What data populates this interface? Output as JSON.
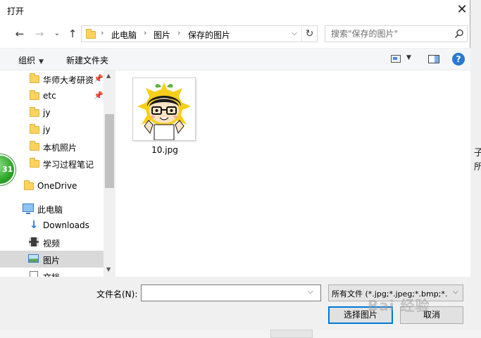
{
  "window": {
    "title": "打开"
  },
  "nav": {
    "back_glyph": "←",
    "forward_glyph": "→",
    "recent_glyph": "⌄",
    "up_glyph": "↑"
  },
  "address": {
    "crumbs": [
      "此电脑",
      "图片",
      "保存的图片"
    ],
    "separator": "›",
    "refresh_glyph": "↻"
  },
  "search": {
    "placeholder": "搜索\"保存的图片\""
  },
  "toolbar": {
    "organize_label": "组织",
    "new_folder_label": "新建文件夹",
    "help_label": "?"
  },
  "sidebar": {
    "items": [
      {
        "label": "华师大考研资",
        "icon": "folder-icon",
        "pinned": true
      },
      {
        "label": "etc",
        "icon": "folder-icon",
        "pinned": true
      },
      {
        "label": "jy",
        "icon": "folder-icon",
        "pinned": false
      },
      {
        "label": "jy",
        "icon": "folder-icon",
        "pinned": false
      },
      {
        "label": "本机照片",
        "icon": "folder-icon",
        "pinned": false
      },
      {
        "label": "学习过程笔记",
        "icon": "folder-icon",
        "pinned": false
      },
      {
        "label": "OneDrive",
        "icon": "onedrive-icon",
        "pinned": false
      },
      {
        "label": "此电脑",
        "icon": "computer-icon",
        "pinned": false
      },
      {
        "label": "Downloads",
        "icon": "download-icon",
        "pinned": false
      },
      {
        "label": "视频",
        "icon": "video-icon",
        "pinned": false
      },
      {
        "label": "图片",
        "icon": "pictures-icon",
        "pinned": false,
        "selected": true
      },
      {
        "label": "文档",
        "icon": "document-icon",
        "pinned": false
      }
    ]
  },
  "files": [
    {
      "name": "10.jpg",
      "type": "image"
    }
  ],
  "bottom": {
    "filename_label": "文件名(N):",
    "filename_value": "",
    "filetype_value": "所有文件 (*.jpg;*.jpeg;*.bmp;*.",
    "open_label": "选择图片",
    "cancel_label": "取消"
  },
  "background": {
    "badge_text": "31",
    "right_text": "子\n所",
    "watermark": "Bai 经验"
  },
  "colors": {
    "accent": "#0078d7",
    "selected_bg": "#d9d9d9",
    "folder": "#ffd35c",
    "help": "#2a78d0"
  }
}
